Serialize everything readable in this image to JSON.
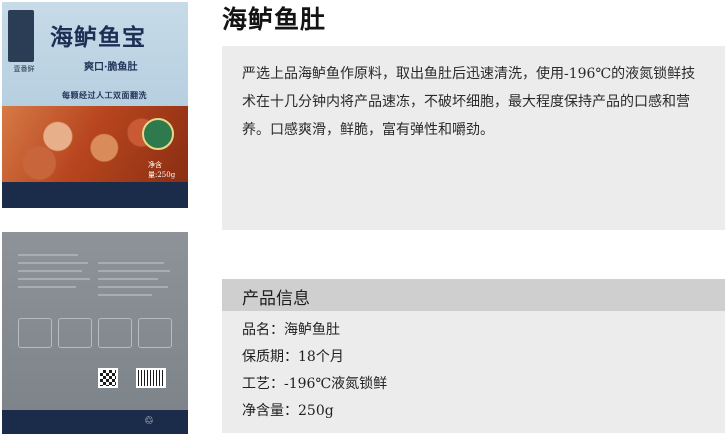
{
  "product_title": "海鲈鱼肚",
  "description": "严选上品海鲈鱼作原料，取出鱼肚后迅速清洗，使用-196℃的液氮锁鲜技术在十几分钟内将产品速冻，不破坏细胞，最大程度保持产品的口感和营养。口感爽滑，鲜脆，富有弹性和嚼劲。",
  "info": {
    "heading": "产品信息",
    "rows": [
      "品名：海鲈鱼肚",
      "保质期：18个月",
      "工艺：-196℃液氮锁鲜",
      "净含量：250g"
    ]
  },
  "package_front": {
    "brand": "壹番鲜",
    "title": "海鲈鱼宝",
    "subtitle": "爽口·脆鱼肚",
    "slogan": "每颗经过人工双面翻洗",
    "weight": "净含量:250g"
  },
  "colors": {
    "desc_bg": "#ececec",
    "info_head_bg": "#cfcfcf",
    "package_navy": "#1b2c4a"
  }
}
